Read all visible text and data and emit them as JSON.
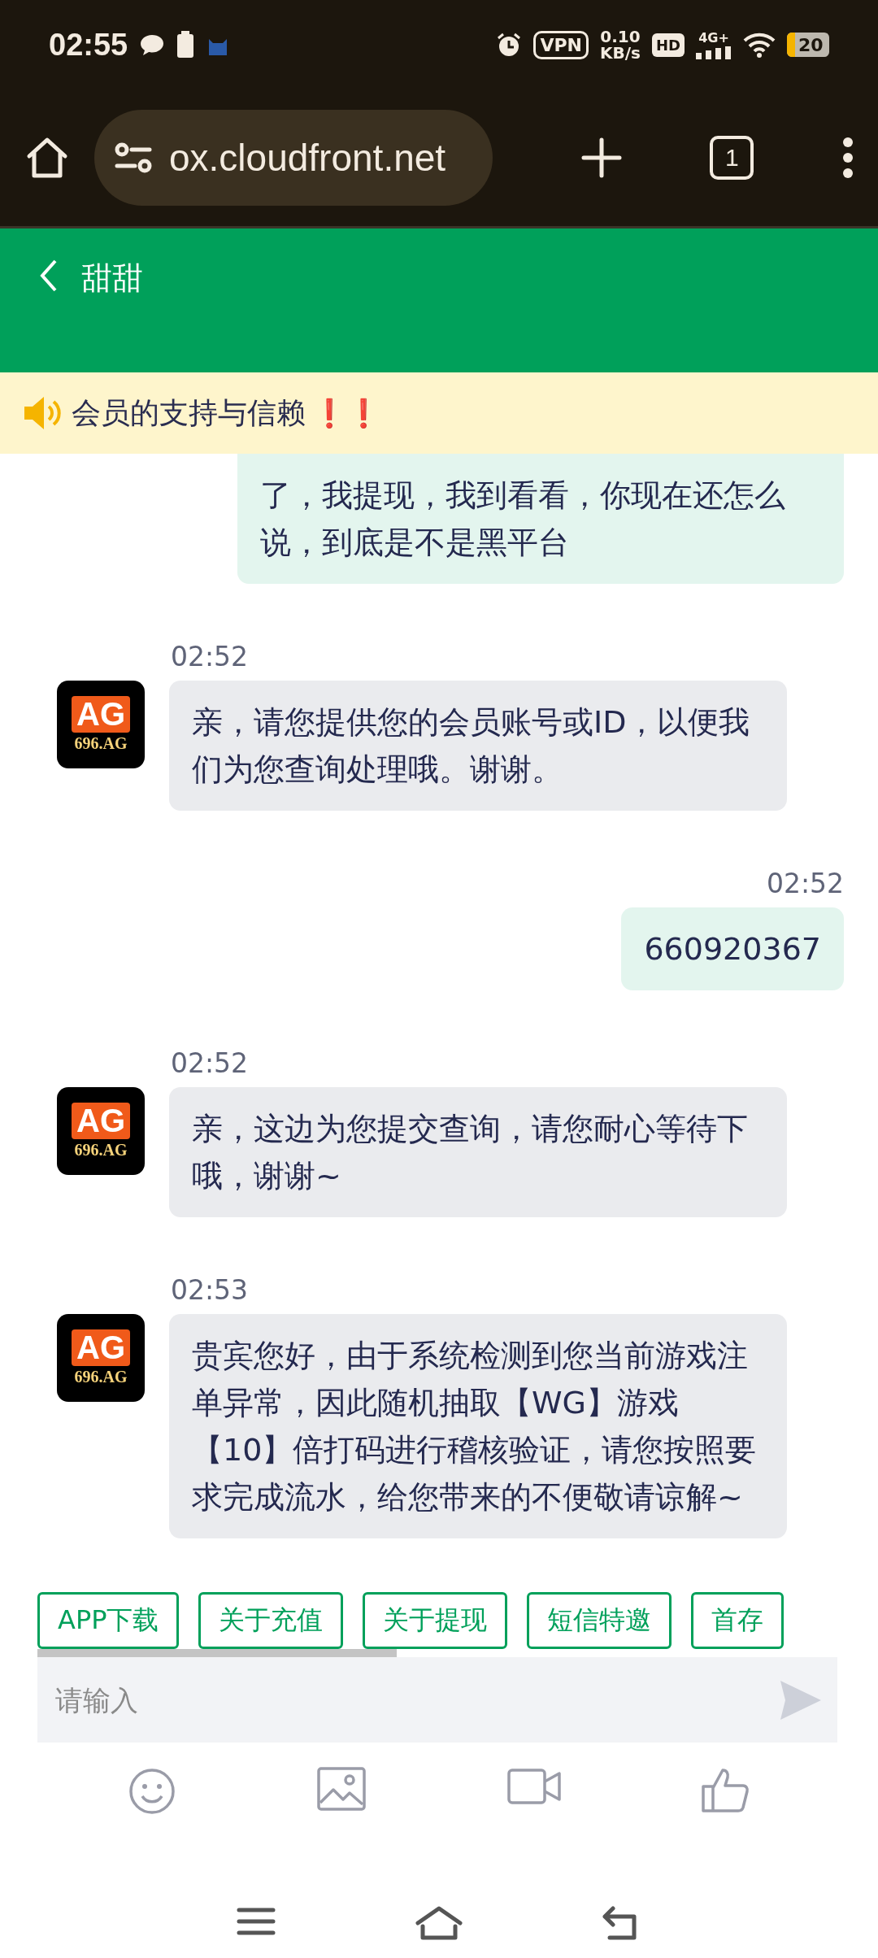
{
  "status_bar": {
    "time": "02:55",
    "vpn": "VPN",
    "speed": "0.10",
    "speed_unit": "KB/s",
    "hd": "HD",
    "network": "4G+",
    "battery": "20"
  },
  "browser": {
    "url": "ox.cloudfront.net",
    "tab_count": "1"
  },
  "header": {
    "title": "甜甜"
  },
  "notice": {
    "text": "会员的支持与信赖",
    "marks": "❗❗"
  },
  "messages": [
    {
      "kind": "user",
      "text": "了，我提现，我到看看，你现在还怎么说，到底是不是黑平台"
    },
    {
      "kind": "agent",
      "time": "02:52",
      "avatar_logo": "AG",
      "avatar_label": "696.AG",
      "text": "亲，请您提供您的会员账号或ID，以便我们为您查询处理哦。谢谢。"
    },
    {
      "kind": "user",
      "time": "02:52",
      "text": "660920367"
    },
    {
      "kind": "agent",
      "time": "02:52",
      "avatar_logo": "AG",
      "avatar_label": "696.AG",
      "text": "亲，这边为您提交查询，请您耐心等待下哦，谢谢~"
    },
    {
      "kind": "agent",
      "time": "02:53",
      "avatar_logo": "AG",
      "avatar_label": "696.AG",
      "text": "贵宾您好，由于系统检测到您当前游戏注单异常，因此随机抽取【WG】游戏【10】倍打码进行稽核验证，请您按照要求完成流水，给您带来的不便敬请谅解~"
    }
  ],
  "quick_replies": [
    "APP下载",
    "关于充值",
    "关于提现",
    "短信特邀",
    "首存"
  ],
  "input": {
    "placeholder": "请输入"
  }
}
